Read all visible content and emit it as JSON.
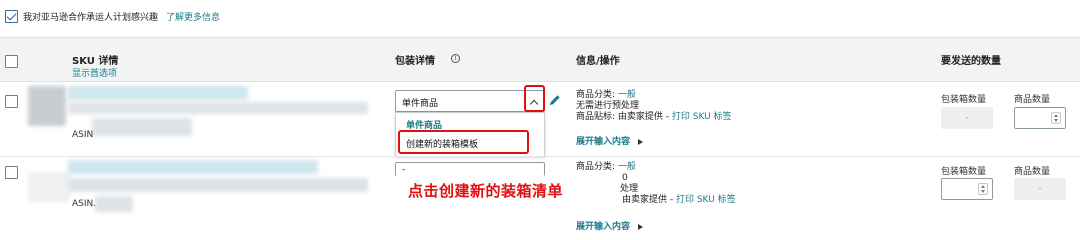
{
  "top": {
    "consent_text": "我对亚马逊合作承运人计划感兴趣",
    "learn_more": "了解更多信息"
  },
  "header": {
    "sku": "SKU 详情",
    "show_options": "显示首选项",
    "packing": "包装详情",
    "info_icon": "i",
    "info_ops": "信息/操作",
    "qty_to_send": "要发送的数量"
  },
  "rows": [
    {
      "asin_label": "ASIN",
      "packing_value": "单件商品",
      "info_category_label": "商品分类: ",
      "info_category_value": "一般",
      "info_prep": "无需进行预处理",
      "info_label_prefix": "商品贴标:  由卖家提供 - ",
      "info_print_link": "打印 SKU 标签",
      "expand": "展开输入内容",
      "box_qty_label": "包装箱数量",
      "unit_qty_label": "商品数量",
      "box_qty_value": "-"
    },
    {
      "asin_label": "ASIN.",
      "packing_value": "-",
      "info_category_label": "商品分类: ",
      "info_category_value": "一般",
      "info_prep_line1": "0",
      "info_prep_line2": "处理",
      "info_label_prefix": "由卖家提供 - ",
      "info_print_link": "打印 SKU 标签",
      "expand": "展开输入内容",
      "box_qty_label": "包装箱数量",
      "unit_qty_label": "商品数量",
      "unit_qty_value": "-"
    }
  ],
  "dropdown": {
    "options": [
      "单件商品",
      "创建新的装箱模板"
    ]
  },
  "annotation": "点击创建新的装箱清单",
  "colors": {
    "accent": "#1a7b8a",
    "annotation": "#e01010"
  }
}
